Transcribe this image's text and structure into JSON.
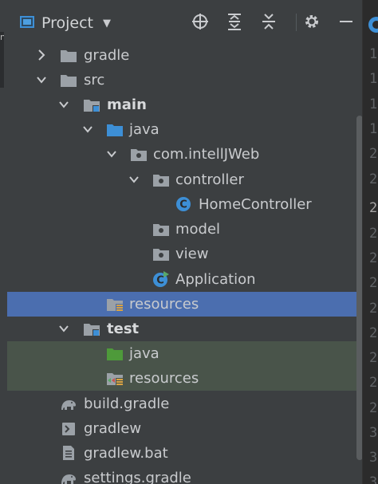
{
  "panel": {
    "title": "Project",
    "caret": "▼"
  },
  "toolbar": {
    "locate_icon": "crosshair-icon",
    "expand_icon": "expand-all-icon",
    "collapse_icon": "collapse-all-icon",
    "settings_icon": "gear-icon",
    "hide_icon": "minimize-icon"
  },
  "left_strip": {
    "text": "n"
  },
  "tree": {
    "items": [
      {
        "label": "gradle",
        "icon": "folder-icon",
        "arrow": "›"
      },
      {
        "label": "src",
        "icon": "folder-icon",
        "arrow": "⌄"
      },
      {
        "label": "main",
        "icon": "source-root-folder-icon",
        "arrow": "⌄"
      },
      {
        "label": "java",
        "icon": "source-folder-icon",
        "arrow": "⌄"
      },
      {
        "label": "com.intellJWeb",
        "icon": "package-icon",
        "arrow": "⌄"
      },
      {
        "label": "controller",
        "icon": "package-icon",
        "arrow": "⌄"
      },
      {
        "label": "HomeController",
        "icon": "class-icon",
        "arrow": "",
        "glyph": "C"
      },
      {
        "label": "model",
        "icon": "package-icon",
        "arrow": ""
      },
      {
        "label": "view",
        "icon": "package-icon",
        "arrow": ""
      },
      {
        "label": "Application",
        "icon": "spring-boot-class-icon",
        "arrow": "",
        "glyph": "C"
      },
      {
        "label": "resources",
        "icon": "resources-folder-icon",
        "arrow": ""
      },
      {
        "label": "test",
        "icon": "test-root-folder-icon",
        "arrow": "⌄"
      },
      {
        "label": "java",
        "icon": "test-source-folder-icon",
        "arrow": ""
      },
      {
        "label": "resources",
        "icon": "test-resources-folder-icon",
        "arrow": ""
      },
      {
        "label": "build.gradle",
        "icon": "gradle-elephant-icon",
        "arrow": ""
      },
      {
        "label": "gradlew",
        "icon": "shell-script-icon",
        "arrow": ""
      },
      {
        "label": "gradlew.bat",
        "icon": "text-file-icon",
        "arrow": ""
      },
      {
        "label": "settings.gradle",
        "icon": "gradle-elephant-icon",
        "arrow": ""
      }
    ]
  },
  "gutter": {
    "numbers": [
      "1",
      "1",
      "1",
      "1",
      "2",
      "2",
      "2",
      "2",
      "2",
      "2",
      "2",
      "2",
      "2",
      "2",
      "2",
      "3",
      "3",
      "3"
    ]
  },
  "colors": {
    "selection": "#4b6eaf",
    "test_highlight": "#49544a",
    "folder": "#9ba1a7",
    "source_folder": "#3d8fd6",
    "test_folder": "#4e9a3a",
    "class_blue": "#3d8fd6"
  }
}
